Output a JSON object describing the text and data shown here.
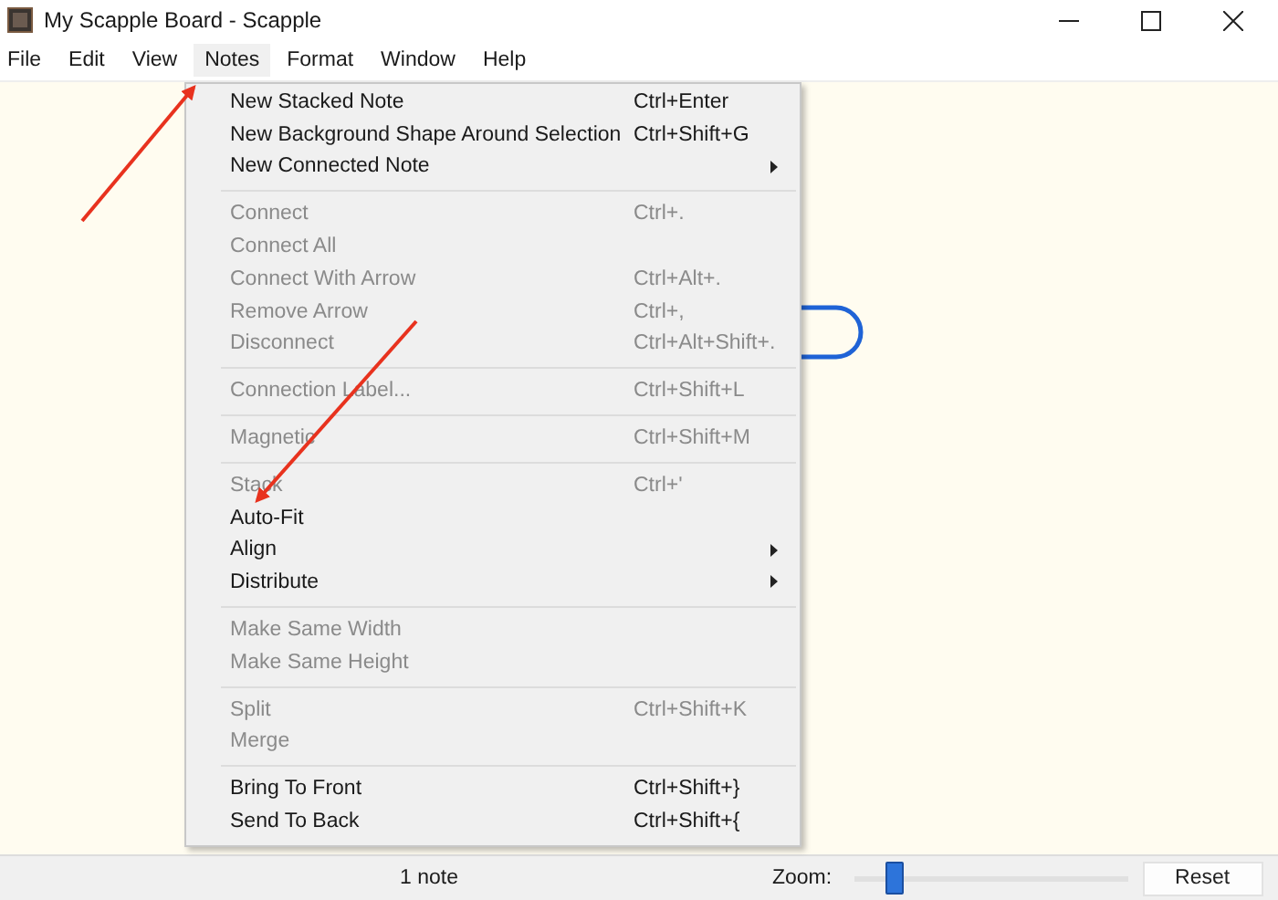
{
  "window": {
    "title": "My Scapple Board - Scapple"
  },
  "menubar": [
    {
      "label": "File",
      "selected": false
    },
    {
      "label": "Edit",
      "selected": false
    },
    {
      "label": "View",
      "selected": false
    },
    {
      "label": "Notes",
      "selected": true
    },
    {
      "label": "Format",
      "selected": false
    },
    {
      "label": "Window",
      "selected": false
    },
    {
      "label": "Help",
      "selected": false
    }
  ],
  "menu": [
    {
      "kind": "item",
      "label": "New Stacked Note",
      "shortcut": "Ctrl+Enter",
      "disabled": false,
      "submenu": false
    },
    {
      "kind": "item",
      "label": "New Background Shape Around Selection",
      "shortcut": "Ctrl+Shift+G",
      "disabled": false,
      "submenu": false
    },
    {
      "kind": "item",
      "label": "New Connected Note",
      "disabled": false,
      "submenu": true
    },
    {
      "kind": "separator"
    },
    {
      "kind": "item",
      "label": "Connect",
      "shortcut": "Ctrl+.",
      "disabled": true,
      "submenu": false
    },
    {
      "kind": "item",
      "label": "Connect All",
      "disabled": true,
      "submenu": false
    },
    {
      "kind": "item",
      "label": "Connect With Arrow",
      "shortcut": "Ctrl+Alt+.",
      "disabled": true,
      "submenu": false
    },
    {
      "kind": "item",
      "label": "Remove Arrow",
      "shortcut": "Ctrl+,",
      "disabled": true,
      "submenu": false
    },
    {
      "kind": "item",
      "label": "Disconnect",
      "shortcut": "Ctrl+Alt+Shift+.",
      "disabled": true,
      "submenu": false
    },
    {
      "kind": "separator"
    },
    {
      "kind": "item",
      "label": "Connection Label...",
      "shortcut": "Ctrl+Shift+L",
      "disabled": true,
      "submenu": false
    },
    {
      "kind": "separator"
    },
    {
      "kind": "item",
      "label": "Magnetic",
      "shortcut": "Ctrl+Shift+M",
      "disabled": true,
      "submenu": false
    },
    {
      "kind": "separator"
    },
    {
      "kind": "item",
      "label": "Stack",
      "shortcut": "Ctrl+'",
      "disabled": true,
      "submenu": false
    },
    {
      "kind": "item",
      "label": "Auto-Fit",
      "disabled": false,
      "submenu": false
    },
    {
      "kind": "item",
      "label": "Align",
      "disabled": false,
      "submenu": true
    },
    {
      "kind": "item",
      "label": "Distribute",
      "disabled": false,
      "submenu": true
    },
    {
      "kind": "separator"
    },
    {
      "kind": "item",
      "label": "Make Same Width",
      "disabled": true,
      "submenu": false
    },
    {
      "kind": "item",
      "label": "Make Same Height",
      "disabled": true,
      "submenu": false
    },
    {
      "kind": "separator"
    },
    {
      "kind": "item",
      "label": "Split",
      "shortcut": "Ctrl+Shift+K",
      "disabled": true,
      "submenu": false
    },
    {
      "kind": "item",
      "label": "Merge",
      "disabled": true,
      "submenu": false
    },
    {
      "kind": "separator"
    },
    {
      "kind": "item",
      "label": "Bring To Front",
      "shortcut": "Ctrl+Shift+}",
      "disabled": false,
      "submenu": false
    },
    {
      "kind": "item",
      "label": "Send To Back",
      "shortcut": "Ctrl+Shift+{",
      "disabled": false,
      "submenu": false
    }
  ],
  "status_bar": {
    "count": "1 note",
    "zoom_label": "Zoom:",
    "zoom": {
      "level": 0.15
    },
    "reset_button": "Reset"
  }
}
